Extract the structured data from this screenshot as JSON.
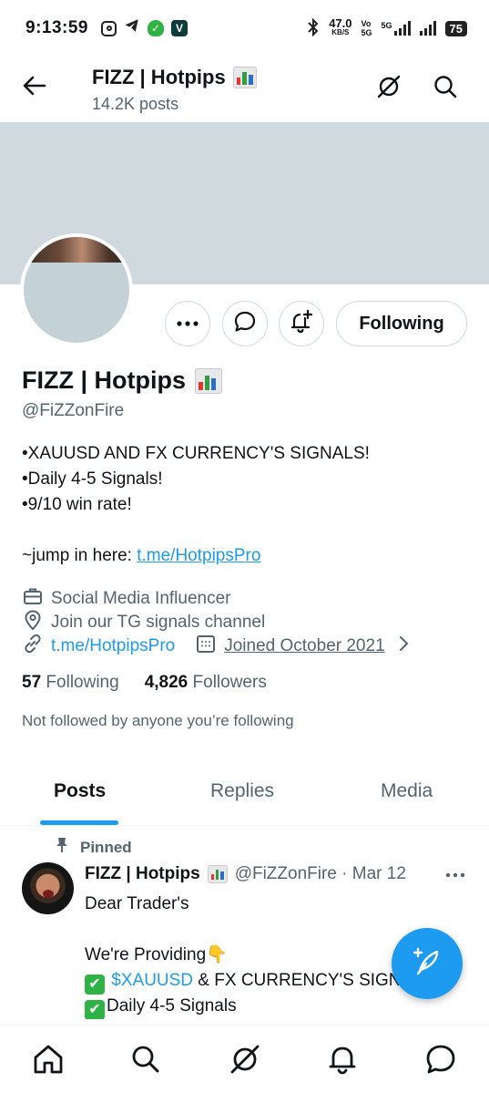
{
  "status_bar": {
    "time": "9:13:59",
    "net_speed": "47.0",
    "net_unit": "KB/S",
    "volte": "Vo",
    "volte_sub": "5G",
    "network": "5G",
    "battery": "75"
  },
  "header": {
    "title": "FIZZ | Hotpips",
    "posts_count": "14.2K posts"
  },
  "profile": {
    "display_name": "FIZZ | Hotpips",
    "handle": "@FiZZonFire",
    "following_button": "Following",
    "bio": [
      "•XAUUSD AND FX CURRENCY'S SIGNALS!",
      "•Daily 4-5 Signals!",
      "•9/10 win rate!",
      "",
      "~jump in here: "
    ],
    "bio_link": "t.me/HotpipsPro",
    "category": "Social Media Influencer",
    "location": "Join our TG signals channel",
    "website": "t.me/HotpipsPro",
    "joined": "Joined October 2021",
    "following_count": "57",
    "following_label": "Following",
    "followers_count": "4,826",
    "followers_label": "Followers",
    "mutual_note": "Not followed by anyone you’re following"
  },
  "tabs": [
    "Posts",
    "Replies",
    "Media"
  ],
  "pinned_post": {
    "pinned_label": "Pinned",
    "author": "FIZZ | Hotpips",
    "handle": "@FiZZonFire · Mar 12",
    "line1": "Dear Trader's",
    "line2": "We're Providing👇",
    "line3_cashtag": "$XAUUSD",
    "line3_rest": " & FX CURRENCY'S SIGNALS",
    "line4": "Daily 4-5 Signals"
  },
  "colors": {
    "accent": "#1d9bf0",
    "banner": "#cfd9de",
    "text_secondary": "#536471"
  }
}
